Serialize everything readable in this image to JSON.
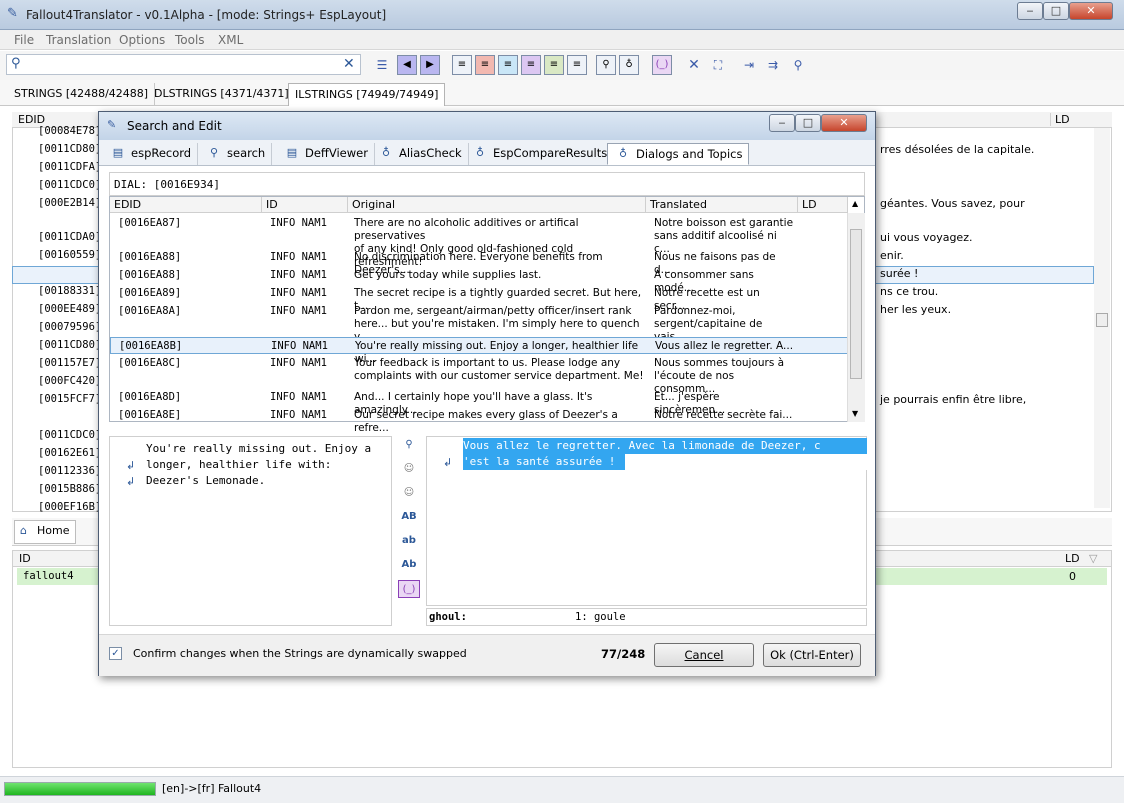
{
  "app": {
    "title": "Fallout4Translator - v0.1Alpha - [mode: Strings+ EspLayout]"
  },
  "menu": [
    "File",
    "Translation",
    "Options",
    "Tools",
    "XML"
  ],
  "string_tabs": [
    "STRINGS [42488/42488]",
    "DLSTRINGS [4371/4371]",
    "ILSTRINGS [74949/74949]"
  ],
  "background_grid": {
    "headers": {
      "edid": "EDID",
      "ld": "LD"
    },
    "edids": [
      "[00084E78]",
      "[0011CD80]",
      "[0011CDFA]",
      "[0011CDC0]",
      "[000E2B14]",
      "[0011CDA0]",
      "[00160559]",
      "[0016EA8B]",
      "[00188331]",
      "[000EE489]",
      "[00079596]",
      "[0011CD80]",
      "[001157E7]",
      "[000FC420]",
      "[0015FCF7]",
      "[0011CDC0]",
      "[00162E61]",
      "[00112336]",
      "[0015B886]",
      "[000EF16B]"
    ],
    "right_texts": [
      "rres désolées de la capitale.",
      "géantes. Vous savez, pour",
      "ui vous voyagez.",
      "enir.",
      "surée !",
      "ns ce trou.",
      "her les yeux.",
      "je pourrais enfin être libre,"
    ]
  },
  "bottom": {
    "tabs": [
      "Home"
    ],
    "headers": {
      "id": "ID",
      "ld": "LD"
    },
    "row": {
      "id": "fallout4",
      "ld": "0"
    }
  },
  "status": {
    "text": "[en]->[fr] Fallout4"
  },
  "dialog": {
    "title": "Search and Edit",
    "tabs": [
      "espRecord",
      "search",
      "DeffViewer",
      "AliasCheck",
      "EspCompareResults",
      "Dialogs and Topics"
    ],
    "dial_label": "DIAL: [0016E934]",
    "columns": [
      "EDID",
      "ID",
      "Original",
      "Translated",
      "LD"
    ],
    "rows": [
      {
        "edid": "[0016EA87]",
        "id": "INFO NAM1",
        "original": "There are no alcoholic additives or artifical preservatives\nof any kind! Only good old-fashioned cold refreshment!",
        "translated": "Notre boisson est garantie\nsans additif alcoolisé ni c..."
      },
      {
        "edid": "[0016EA88]",
        "id": "INFO NAM1",
        "original": "No discrimination here. Everyone benefits from Deezer's...",
        "translated": "Nous ne faisons pas de d..."
      },
      {
        "edid": "[0016EA88]",
        "id": "INFO NAM1",
        "original": "Get yours today while supplies last.",
        "translated": "À consommer sans modé..."
      },
      {
        "edid": "[0016EA89]",
        "id": "INFO NAM1",
        "original": "The secret recipe is a tightly guarded secret. But here, t...",
        "translated": "Notre recette est un secr..."
      },
      {
        "edid": "[0016EA8A]",
        "id": "INFO NAM1",
        "original": "Pardon me, sergeant/airman/petty officer/insert rank\nhere... but you're mistaken. I'm simply here to quench y...",
        "translated": "Pardonnez-moi,\nsergent/capitaine de vais..."
      },
      {
        "edid": "[0016EA8B]",
        "id": "INFO NAM1",
        "original": "You're really missing out. Enjoy a longer, healthier life wi...",
        "translated": "Vous allez le regretter. A..."
      },
      {
        "edid": "[0016EA8C]",
        "id": "INFO NAM1",
        "original": "Your feedback is important to us. Please lodge any\ncomplaints with our customer service department. Me!",
        "translated": "Nous sommes toujours à\nl'écoute de nos consomm..."
      },
      {
        "edid": "[0016EA8D]",
        "id": "INFO NAM1",
        "original": "And... I certainly hope you'll have a glass. It's amazingly...",
        "translated": "Et... j'espère sincèremen..."
      },
      {
        "edid": "[0016EA8E]",
        "id": "INFO NAM1",
        "original": "Our secret recipe makes every glass of Deezer's a refre...",
        "translated": "Notre recette secrète fai..."
      }
    ],
    "original_text": "You're really missing out. Enjoy a\nlonger, healthier life with:\nDeezer's Lemonade.",
    "translated_text": "Vous allez le regretter. Avec la limonade de Deezer, c\n'est la santé assurée !",
    "glossary": {
      "term": "ghoul:",
      "entry": "1: goule"
    },
    "mid_buttons": [
      "AB",
      "ab",
      "Ab",
      "(_)"
    ],
    "confirm_label": "Confirm changes when the Strings are dynamically swapped",
    "counter": "77/248",
    "cancel_label": "Cancel",
    "ok_label": "Ok (Ctrl-Enter)"
  }
}
